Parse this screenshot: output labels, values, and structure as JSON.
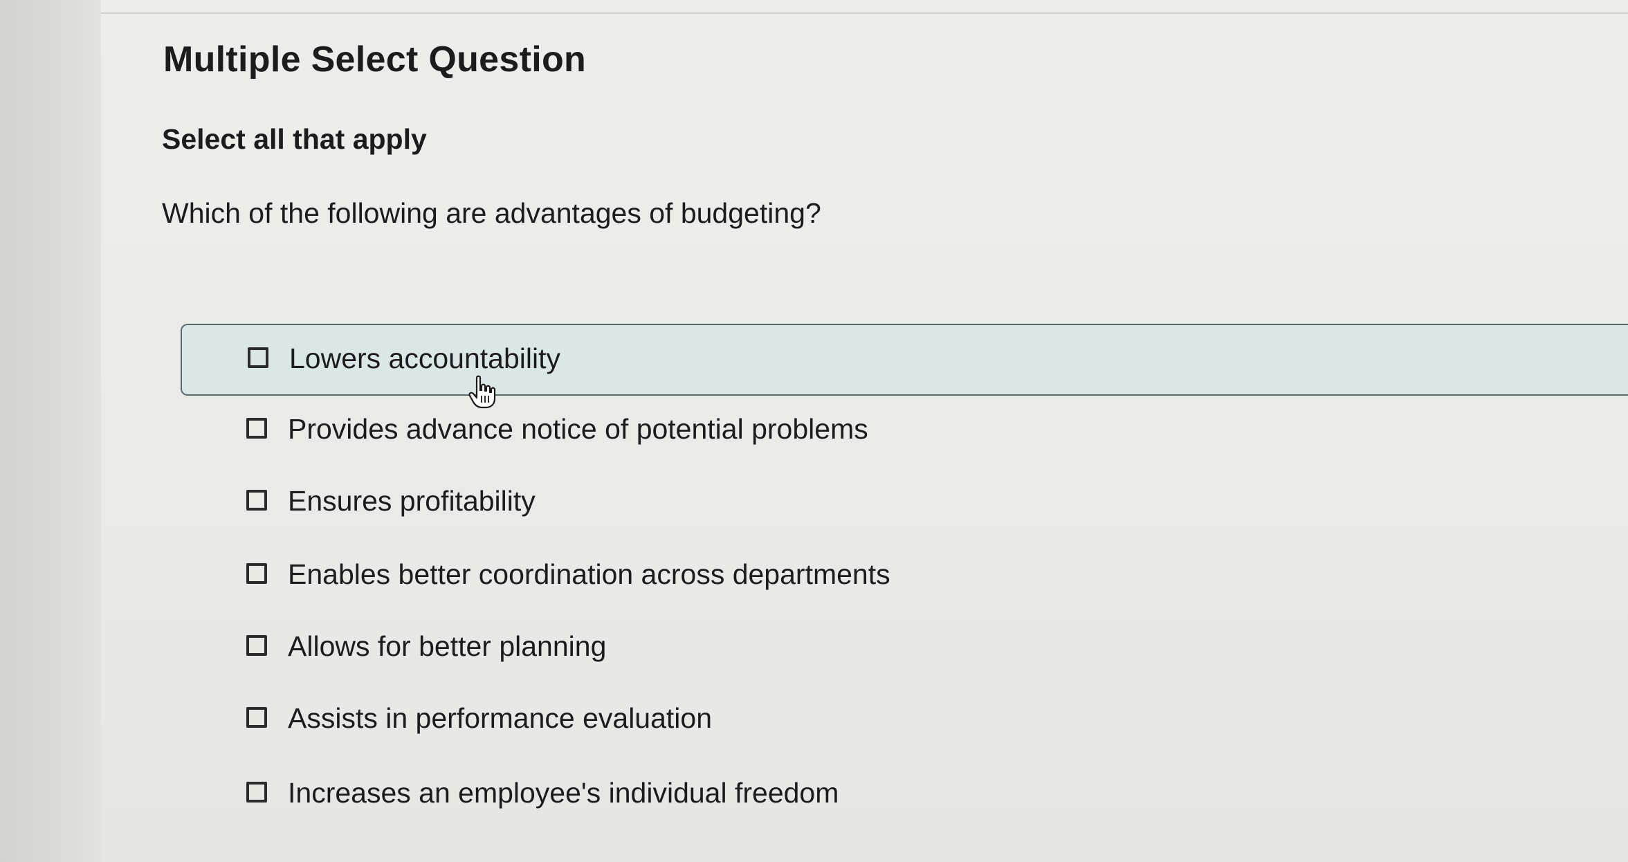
{
  "question_block": {
    "title": "Multiple Select Question",
    "instruction": "Select all that apply",
    "prompt": "Which of the following are advantages of budgeting?"
  },
  "options": [
    {
      "label": "Lowers accountability",
      "checked": false,
      "hovered": true
    },
    {
      "label": "Provides advance notice of potential problems",
      "checked": false,
      "hovered": false
    },
    {
      "label": "Ensures profitability",
      "checked": false,
      "hovered": false
    },
    {
      "label": "Enables better coordination across departments",
      "checked": false,
      "hovered": false
    },
    {
      "label": "Allows for better planning",
      "checked": false,
      "hovered": false
    },
    {
      "label": "Assists in performance evaluation",
      "checked": false,
      "hovered": false
    },
    {
      "label": "Increases an employee's individual freedom",
      "checked": false,
      "hovered": false
    }
  ],
  "icons": {
    "checkbox": "checkbox-empty-icon",
    "cursor": "hand-pointer-icon"
  },
  "colors": {
    "hover_background": "#dbe7e6",
    "hover_border": "#5d6a6b",
    "text": "#1c1c1c"
  }
}
